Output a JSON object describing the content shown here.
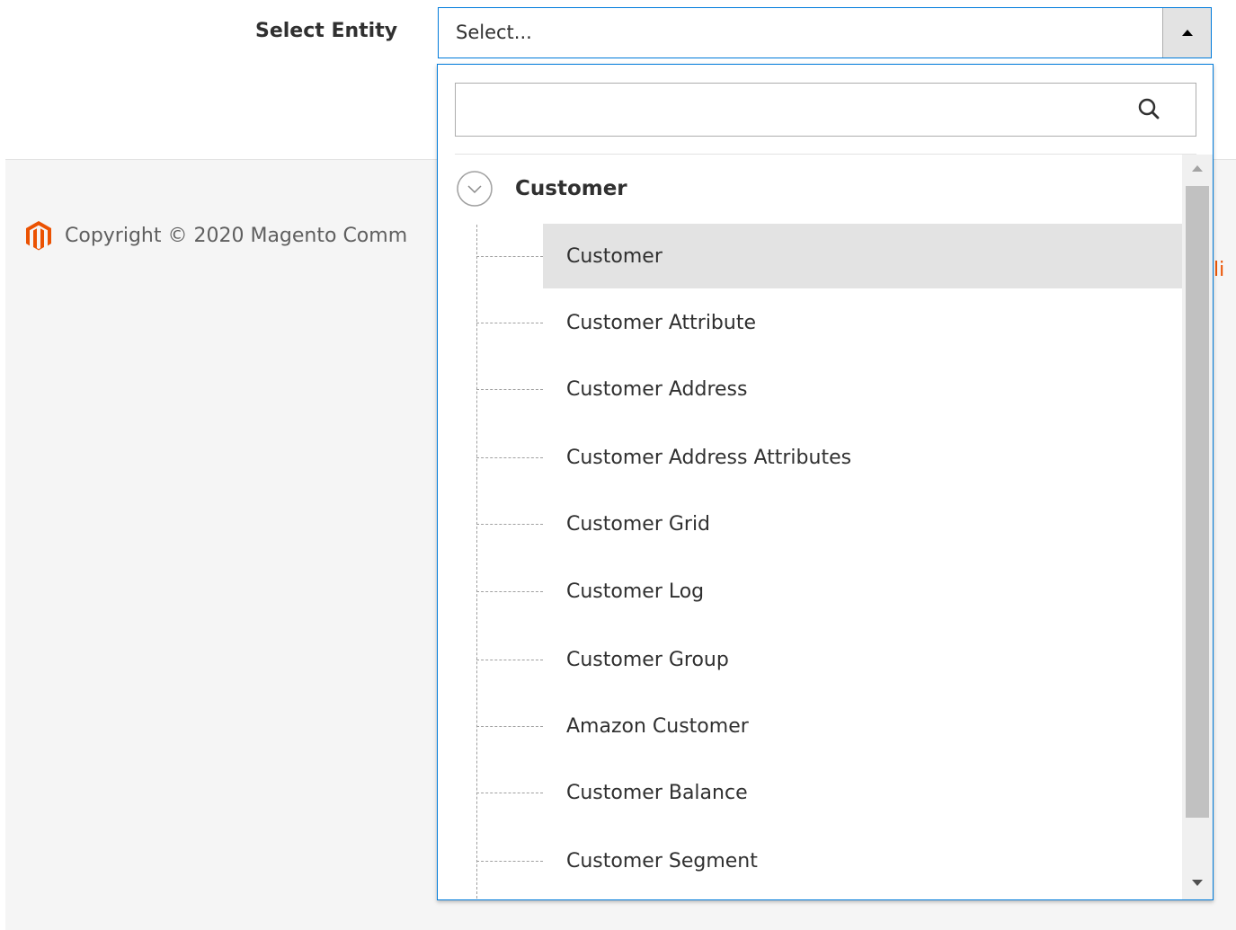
{
  "form": {
    "label": "Select Entity",
    "select_value": "Select..."
  },
  "footer": {
    "copyright": "Copyright © 2020 Magento Comm",
    "link_fragment": "li"
  },
  "dropdown": {
    "search_value": "",
    "group": {
      "label": "Customer",
      "expanded": true
    },
    "options": [
      {
        "label": "Customer",
        "selected": true
      },
      {
        "label": "Customer Attribute",
        "selected": false
      },
      {
        "label": "Customer Address",
        "selected": false
      },
      {
        "label": "Customer Address Attributes",
        "selected": false
      },
      {
        "label": "Customer Grid",
        "selected": false
      },
      {
        "label": "Customer Log",
        "selected": false
      },
      {
        "label": "Customer Group",
        "selected": false
      },
      {
        "label": "Amazon Customer",
        "selected": false
      },
      {
        "label": "Customer Balance",
        "selected": false
      },
      {
        "label": "Customer Segment",
        "selected": false
      }
    ]
  },
  "colors": {
    "focus_border": "#007bdb",
    "selected_bg": "#e3e3e3",
    "brand": "#eb5202",
    "footer_bg": "#f5f5f5"
  }
}
